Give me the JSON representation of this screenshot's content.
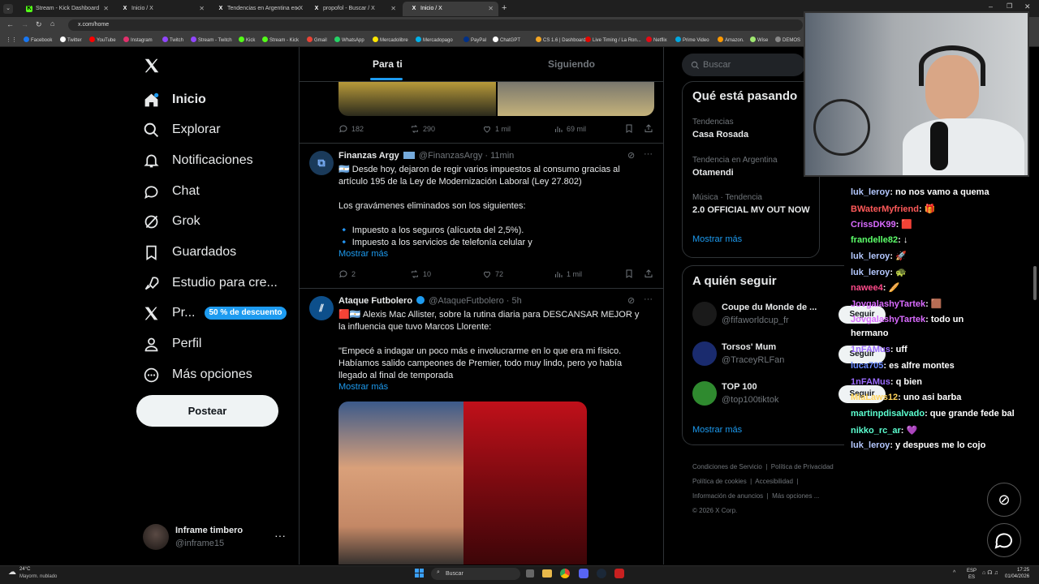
{
  "browser": {
    "tabs": [
      {
        "label": "Stream - Kick Dashboard",
        "icon": "kick-icon",
        "color": "#53fc18"
      },
      {
        "label": "Inicio / X",
        "icon": "x-icon",
        "color": "#ffffff"
      },
      {
        "label": "Tendencias en Argentina en X",
        "icon": "x-icon",
        "color": "#ffffff"
      },
      {
        "label": "propofol - Buscar / X",
        "icon": "x-icon",
        "color": "#ffffff"
      },
      {
        "label": "Inicio / X",
        "icon": "x-icon",
        "color": "#ffffff",
        "active": true
      }
    ],
    "url": "x.com/home",
    "bookmarks": [
      "Facebook",
      "Twitter",
      "YouTube",
      "Instagram",
      "Twitch",
      "Stream - Twitch",
      "Kick",
      "Stream - Kick",
      "Gmail",
      "WhatsApp",
      "Mercadolibre",
      "Mercadopago",
      "PayPal",
      "ChatGPT",
      "CS 1.6 | Dashboard",
      "Live Timing / La Ron...",
      "Netflix",
      "Prime Video",
      "Amazon.",
      "Wise",
      "DEMOS"
    ]
  },
  "sidebar": {
    "items": [
      {
        "label": "Inicio",
        "icon": "home-icon"
      },
      {
        "label": "Explorar",
        "icon": "search-icon"
      },
      {
        "label": "Notificaciones",
        "icon": "bell-icon"
      },
      {
        "label": "Chat",
        "icon": "chat-icon"
      },
      {
        "label": "Grok",
        "icon": "grok-icon"
      },
      {
        "label": "Guardados",
        "icon": "bookmark-icon"
      },
      {
        "label": "Estudio para cre...",
        "icon": "rocket-icon"
      },
      {
        "label": "Pr...",
        "icon": "x-icon"
      },
      {
        "label": "Perfil",
        "icon": "person-icon"
      },
      {
        "label": "Más opciones",
        "icon": "more-circle-icon"
      }
    ],
    "premium_badge": "50 % de descuento",
    "post_button": "Postear",
    "account": {
      "name": "Inframe timbero",
      "handle": "@inframe15"
    }
  },
  "timeline": {
    "tabs": [
      "Para ti",
      "Siguiendo"
    ],
    "first_actions": {
      "replies": "182",
      "reposts": "290",
      "likes": "1 mil",
      "views": "69 mil"
    },
    "tweets": [
      {
        "name": "Finanzas Argy",
        "handle": "@FinanzasArgy",
        "time": "11min",
        "lines": [
          "🇦🇷 Desde hoy, dejaron de regir varios impuestos al consumo gracias al",
          "artículo 195 de la Ley de Modernización Laboral (Ley 27.802)",
          "",
          "Los gravámenes eliminados son los siguientes:",
          "",
          "🔹 Impuesto a los seguros (alícuota del 2,5%).",
          "🔹 Impuesto a los servicios de telefonía celular y"
        ],
        "more": "Mostrar más",
        "replies": "2",
        "reposts": "10",
        "likes": "72",
        "views": "1 mil"
      },
      {
        "name": "Ataque Futbolero",
        "handle": "@AtaqueFutbolero",
        "time": "5h",
        "lines": [
          "🟥🇦🇷 Alexis Mac Allister, sobre la rutina diaria para DESCANSAR MEJOR y",
          "la influencia que tuvo Marcos Llorente:",
          "",
          "\"Empecé a indagar un poco más e involucrarme en lo que era mi físico.",
          "Habíamos salido campeones de Premier, todo muy lindo, pero yo había",
          "llegado al final de temporada"
        ],
        "more": "Mostrar más"
      }
    ]
  },
  "right": {
    "search_placeholder": "Buscar",
    "trends_title": "Qué está pasando",
    "trends": [
      {
        "sub": "Tendencias",
        "title": "Casa Rosada"
      },
      {
        "sub": "Tendencia en Argentina",
        "title": "Otamendi"
      },
      {
        "sub": "Música · Tendencia",
        "title": "2.0 OFFICIAL MV OUT NOW"
      }
    ],
    "show_more": "Mostrar más",
    "follow_title": "A quién seguir",
    "follow": [
      {
        "name": "Coupe du Monde de ...",
        "handle": "@fifaworldcup_fr",
        "button": "Seguir"
      },
      {
        "name": "Torsos' Mum",
        "handle": "@TraceyRLFan",
        "button": "Seguir"
      },
      {
        "name": "TOP 100",
        "handle": "@top100tiktok",
        "button": "Seguir"
      }
    ],
    "footer": [
      "Condiciones de Servicio",
      "Política de Privacidad",
      "Política de cookies",
      "Accesibilidad",
      "Información de anuncios",
      "Más opciones ...",
      "© 2026 X Corp."
    ]
  },
  "chat": [
    {
      "user": "luk_leroy",
      "msg": ": no nos vamo a quema",
      "color": "#b4c8ff"
    },
    {
      "user": "BWaterMyfriend",
      "msg": ": 🎁",
      "color": "#ff5a5a"
    },
    {
      "user": "CrissDK99",
      "msg": ": 🟥",
      "color": "#d96bff"
    },
    {
      "user": "frandelle82",
      "msg": ": ↓",
      "color": "#5cff6a"
    },
    {
      "user": "luk_leroy",
      "msg": ": 🚀",
      "color": "#b4c8ff"
    },
    {
      "user": "luk_leroy",
      "msg": ": 🐢",
      "color": "#b4c8ff"
    },
    {
      "user": "nawee4",
      "msg": ": 🥖",
      "color": "#ff4a8a"
    },
    {
      "user": "JovgalashyTartek",
      "msg": ": 🟫",
      "color": "#d96bff"
    },
    {
      "user": "JovgalashyTartek",
      "msg": ": todo un",
      "color": "#d96bff"
    },
    {
      "user": "",
      "msg": "hermano",
      "color": "#ffffff"
    },
    {
      "user": "1nFAMus",
      "msg": ": uff",
      "color": "#9b6bff"
    },
    {
      "user": "luca705",
      "msg": ": es alfre montes",
      "color": "#6b8bff"
    },
    {
      "user": "1nFAMus",
      "msg": ": q bien",
      "color": "#9b6bff"
    },
    {
      "user": "MiaLaws12",
      "msg": ": uno asi barba",
      "color": "#ffd35a"
    },
    {
      "user": "martinpdisalvado",
      "msg": ": que grande fede bal",
      "color": "#5cffd0"
    },
    {
      "user": "nikko_rc_ar",
      "msg": ": 💜",
      "color": "#5cffd0"
    },
    {
      "user": "luk_leroy",
      "msg": ": y despues me lo cojo",
      "color": "#b4c8ff"
    }
  ],
  "taskbar": {
    "weather_temp": "24°C",
    "weather_desc": "Mayorm. nublado",
    "search": "Buscar",
    "lang1": "ESP",
    "lang2": "ES",
    "time": "17:25",
    "date": "01/04/2026"
  }
}
